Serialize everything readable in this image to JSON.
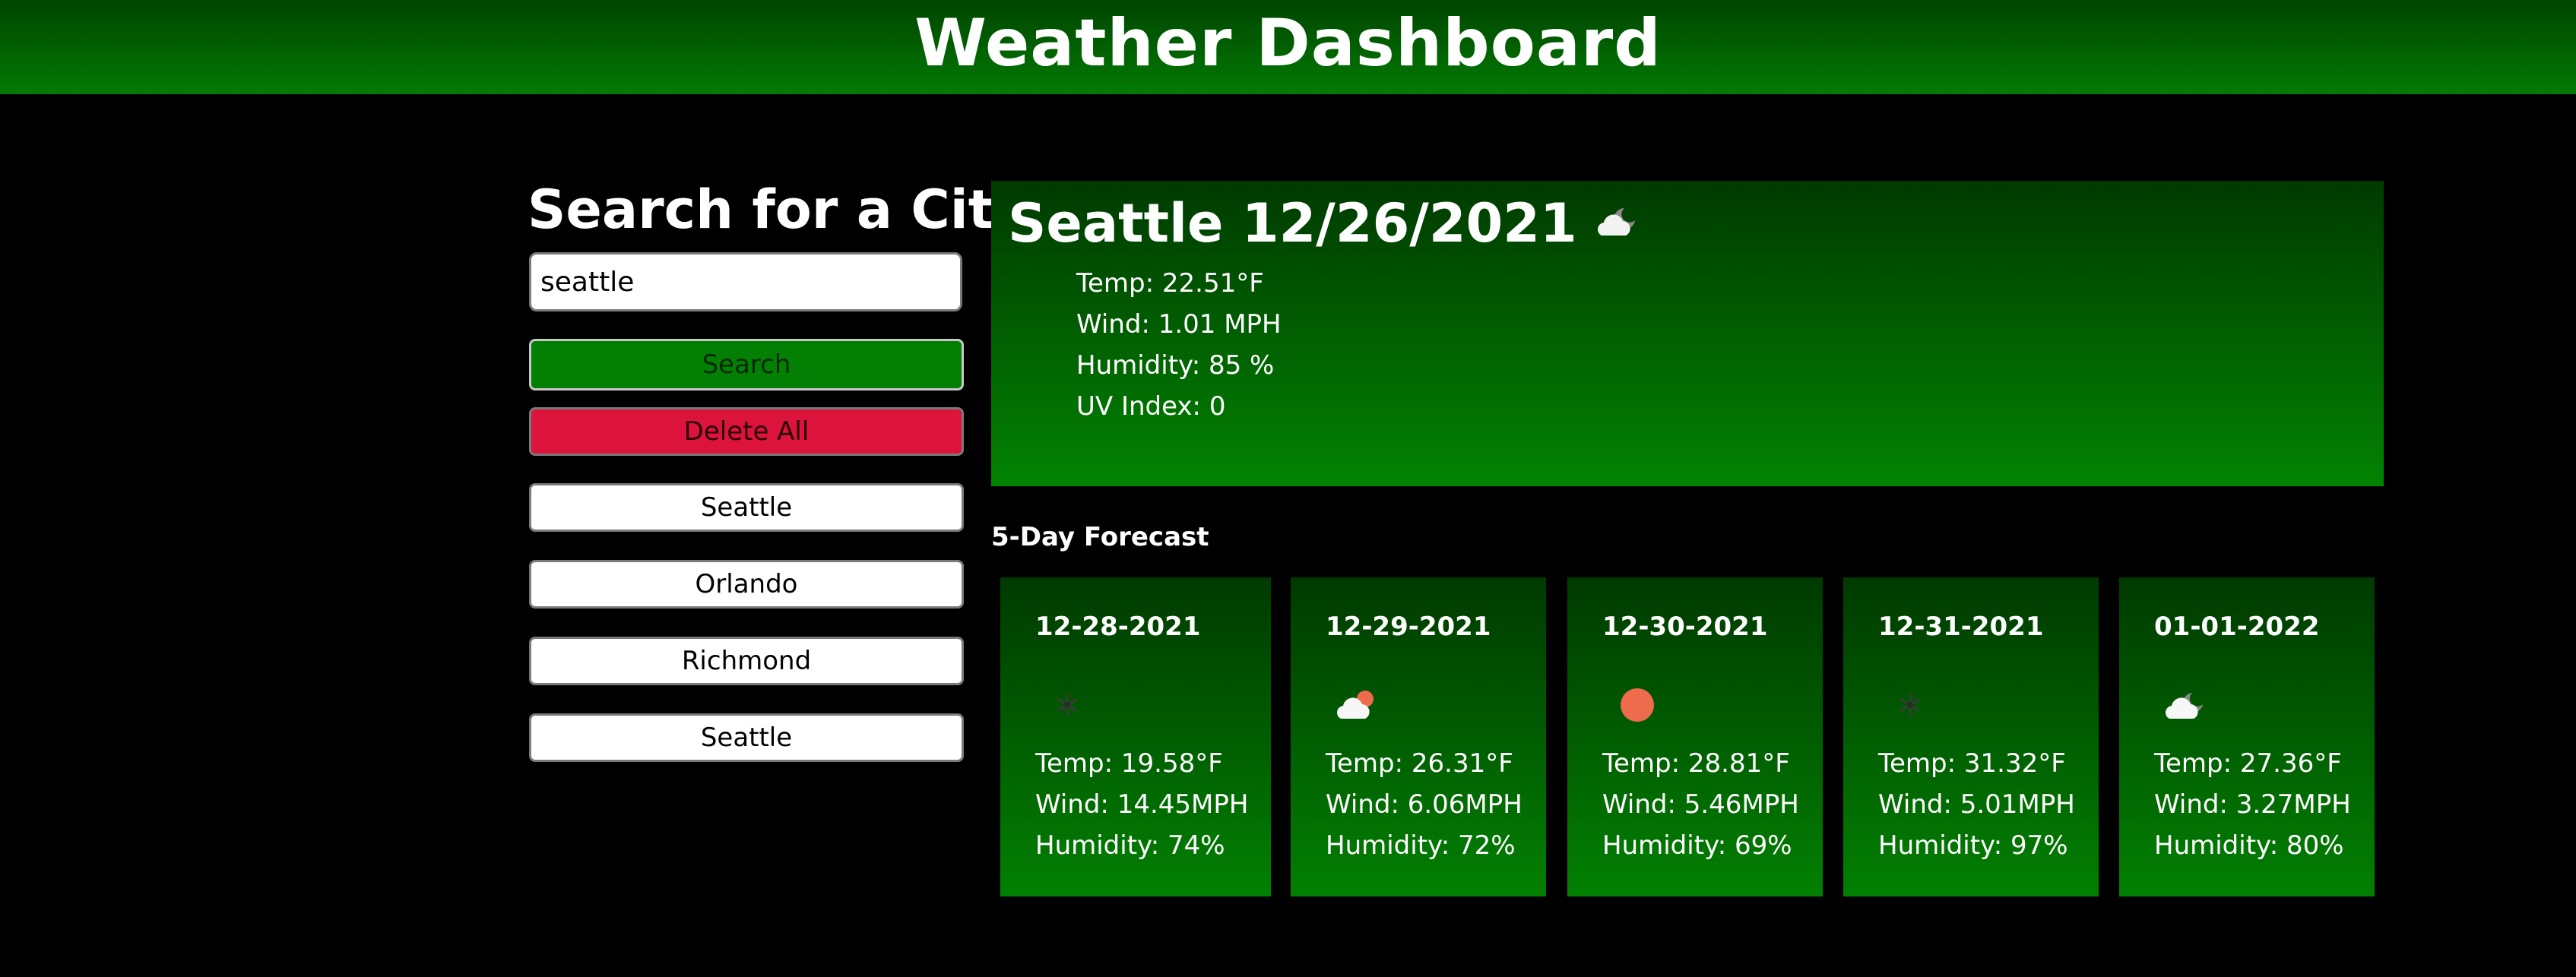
{
  "header": {
    "title": "Weather Dashboard"
  },
  "search": {
    "heading": "Search for a City:",
    "input_value": "seattle",
    "search_label": "Search",
    "delete_label": "Delete All"
  },
  "history": [
    "Seattle",
    "Orlando",
    "Richmond",
    "Seattle"
  ],
  "current": {
    "title": "Seattle 12/26/2021",
    "icon": "cloudy-night-icon",
    "temp": "Temp: 22.51°F",
    "wind": "Wind: 1.01 MPH",
    "humidity": "Humidity: 85 %",
    "uv": "UV Index: 0"
  },
  "forecast_heading": "5-Day Forecast",
  "forecast": [
    {
      "date": "12-28-2021",
      "icon": "snow-icon",
      "temp": "Temp: 19.58°F",
      "wind": "Wind: 14.45MPH",
      "humidity": "Humidity: 74%"
    },
    {
      "date": "12-29-2021",
      "icon": "partly-cloudy-day-icon",
      "temp": "Temp: 26.31°F",
      "wind": "Wind: 6.06MPH",
      "humidity": "Humidity: 72%"
    },
    {
      "date": "12-30-2021",
      "icon": "clear-sun-icon",
      "temp": "Temp: 28.81°F",
      "wind": "Wind: 5.46MPH",
      "humidity": "Humidity: 69%"
    },
    {
      "date": "12-31-2021",
      "icon": "snow-icon",
      "temp": "Temp: 31.32°F",
      "wind": "Wind: 5.01MPH",
      "humidity": "Humidity: 97%"
    },
    {
      "date": "01-01-2022",
      "icon": "cloudy-night-icon",
      "temp": "Temp: 27.36°F",
      "wind": "Wind: 3.27MPH",
      "humidity": "Humidity: 80%"
    }
  ],
  "colors": {
    "header_gradient_top": "#004500",
    "header_gradient_bottom": "#037a03",
    "search_button": "#038003",
    "delete_button": "#dc143c",
    "sun": "#ee6b4d"
  }
}
